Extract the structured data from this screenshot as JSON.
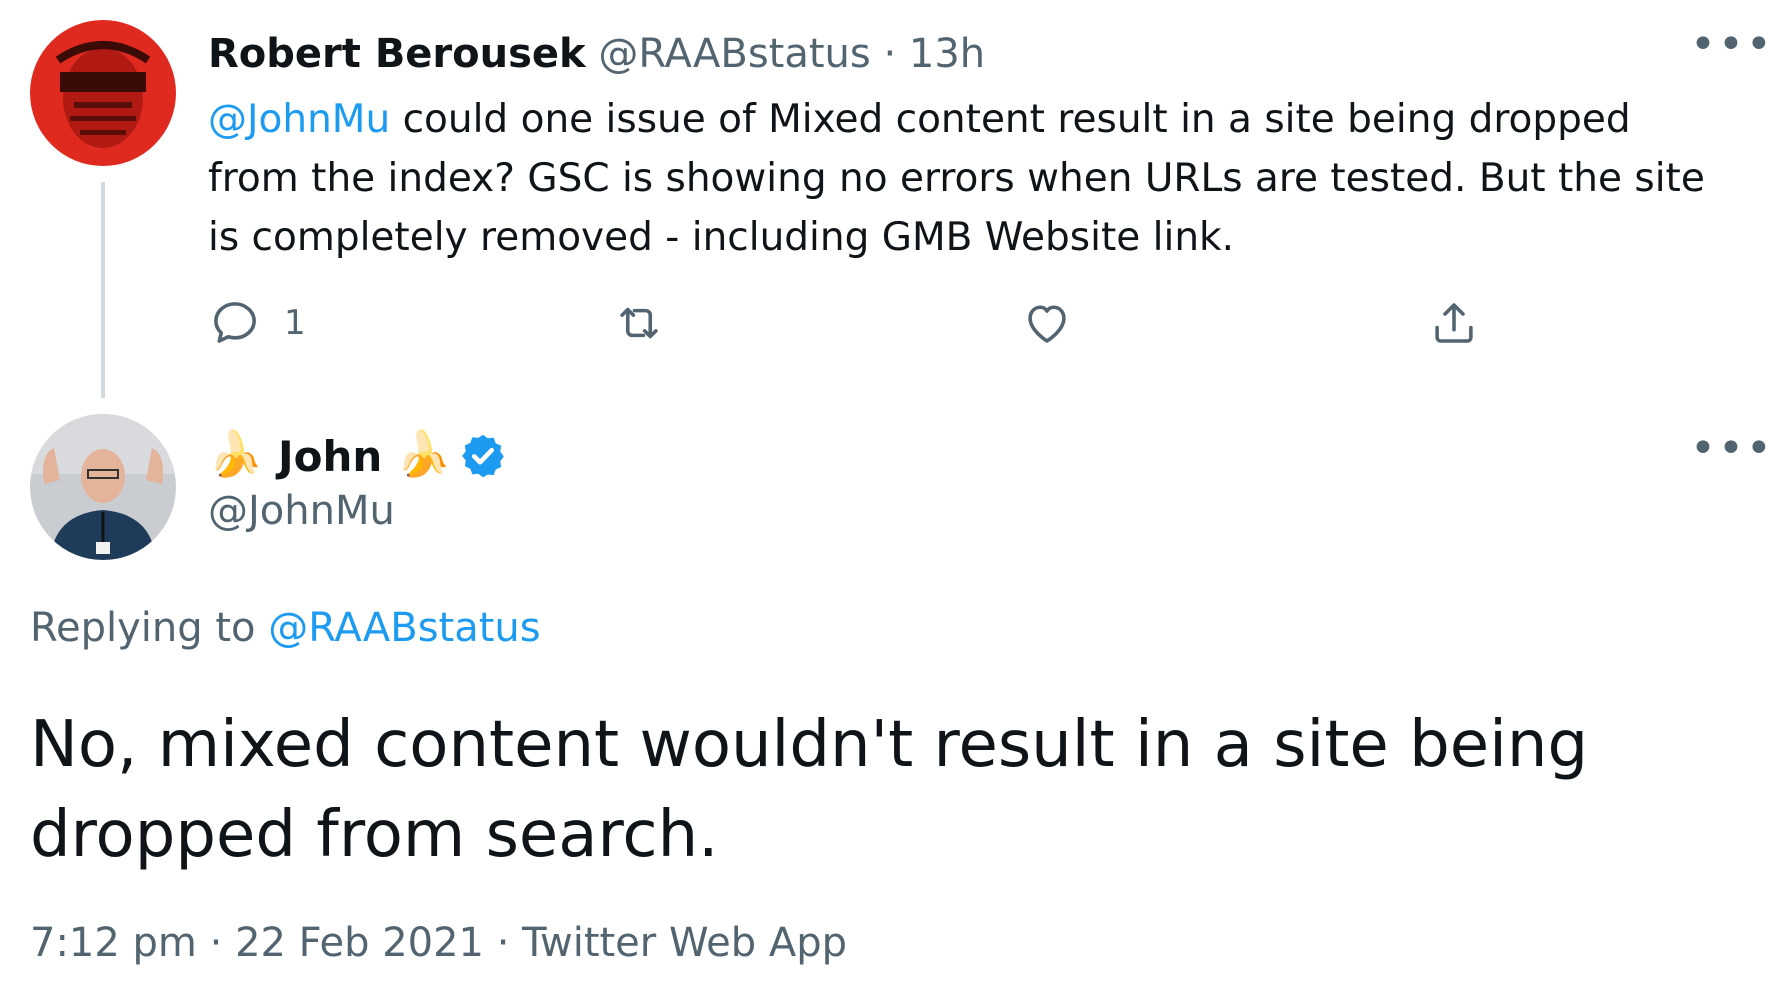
{
  "tweet1": {
    "name": "Robert Berousek",
    "handle": "@RAABstatus",
    "separator": "·",
    "time": "13h",
    "mention": "@JohnMu",
    "text": " could one issue of Mixed content result in a site being dropped from the index? GSC is showing no errors when URLs are tested. But the site is completely removed - including GMB Website link.",
    "more_label": "•••",
    "actions": {
      "reply_icon": "reply-icon",
      "reply_count": "1",
      "retweet_icon": "retweet-icon",
      "like_icon": "heart-icon",
      "share_icon": "share-icon"
    },
    "avatar_color": "#e0291f"
  },
  "tweet2": {
    "name_prefix_emoji": "🍌",
    "name": "John",
    "name_suffix_emoji": "🍌",
    "verified_icon": "verified-badge-icon",
    "handle": "@JohnMu",
    "more_label": "•••",
    "replying_prefix": "Replying to ",
    "replying_handle": "@RAABstatus",
    "text": "No, mixed content wouldn't result in a site being dropped from search.",
    "meta": {
      "time": "7:12 pm",
      "separator1": " · ",
      "date": "22 Feb 2021",
      "separator2": " · ",
      "source": "Twitter Web App"
    }
  },
  "colors": {
    "link": "#1d9bf0",
    "muted": "#536471",
    "text": "#0f1419",
    "verified": "#1d9bf0",
    "thread_line": "#cfd9de"
  }
}
